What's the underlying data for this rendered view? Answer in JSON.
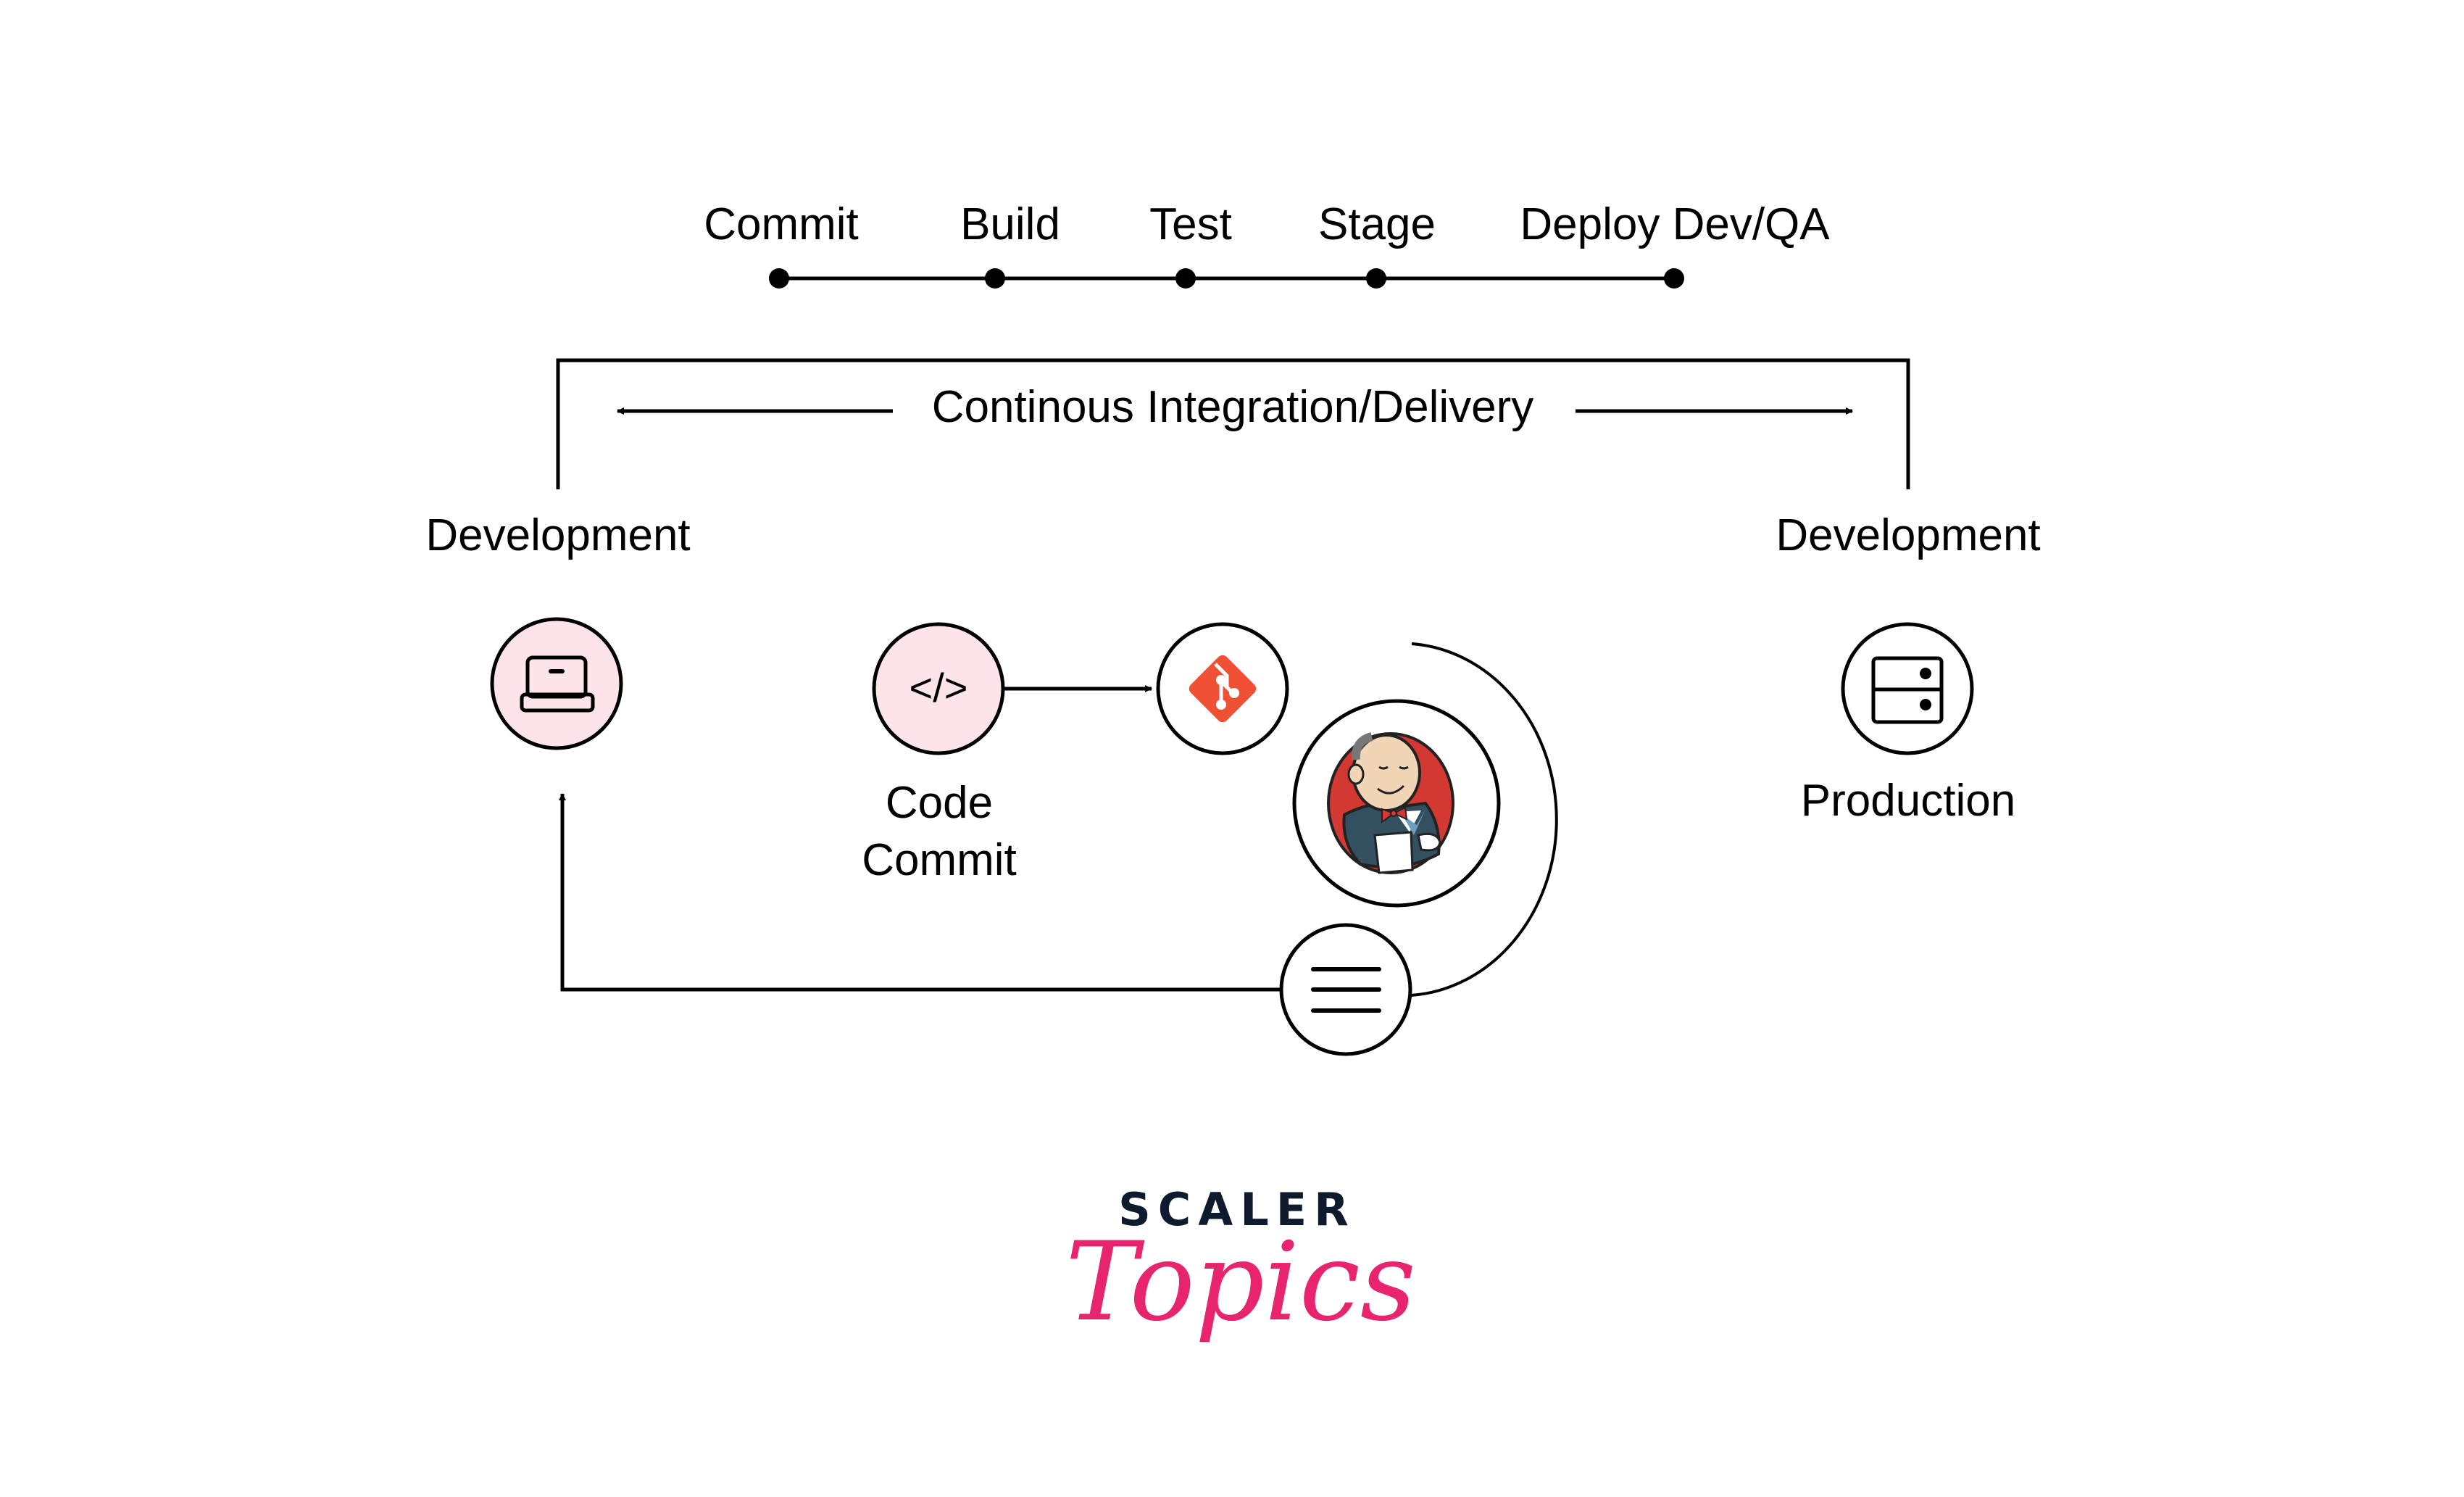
{
  "pipeline": {
    "stages": [
      "Commit",
      "Build",
      "Test",
      "Stage",
      "Deploy Dev/QA"
    ]
  },
  "ci_cd": {
    "label": "Continous Integration/Delivery"
  },
  "environments": {
    "left_label": "Development",
    "right_label": "Development",
    "production_label": "Production"
  },
  "nodes": {
    "developer": {
      "icon": "laptop-icon"
    },
    "code_commit": {
      "icon": "code-icon",
      "glyph": "</>",
      "label_line1": "Code",
      "label_line2": "Commit"
    },
    "git": {
      "icon": "git-icon"
    },
    "jenkins": {
      "icon": "jenkins-icon"
    },
    "feedback": {
      "icon": "menu-lines-icon"
    },
    "production": {
      "icon": "server-icon"
    }
  },
  "brand": {
    "name": "SCALER",
    "sub": "Topics"
  },
  "colors": {
    "line": "#000000",
    "node_fill_pink": "#fde4e9",
    "git_orange": "#f05033",
    "jenkins_red": "#d33833",
    "jenkins_blue": "#335061",
    "brand_navy": "#0e1a2e",
    "brand_pink": "#e8246f"
  }
}
